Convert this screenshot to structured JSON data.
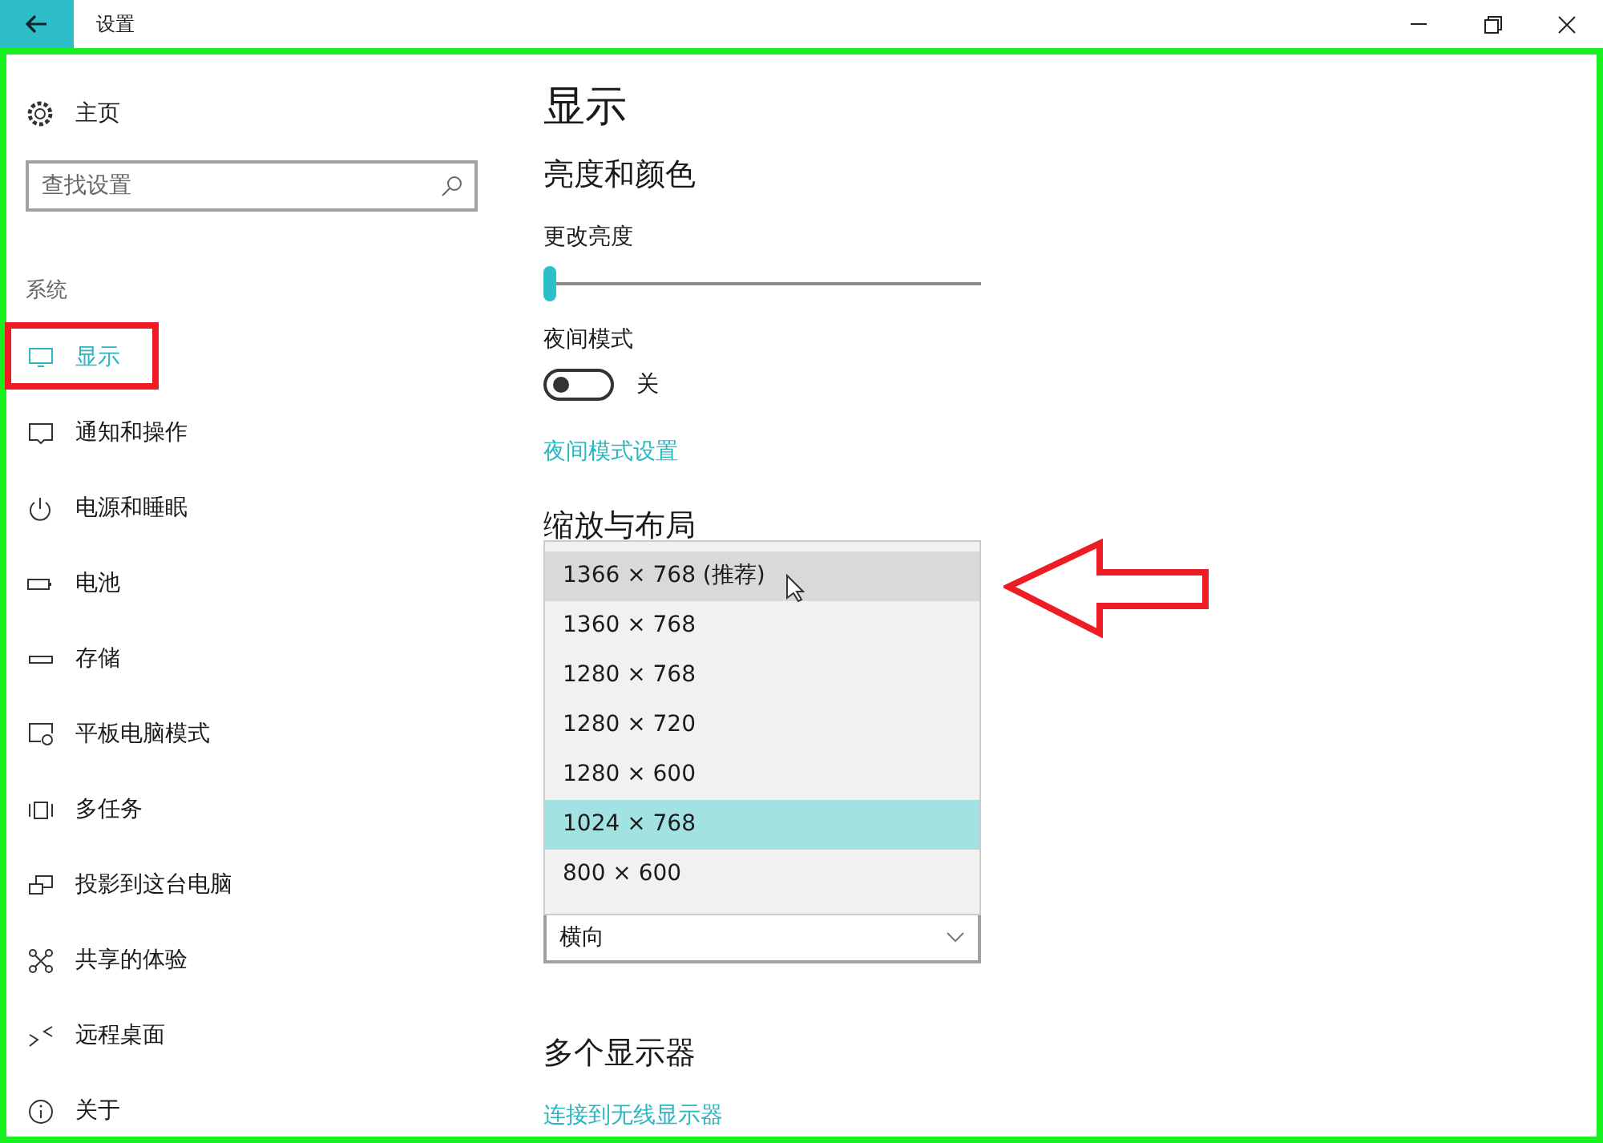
{
  "window": {
    "title": "设置"
  },
  "sidebar": {
    "home": "主页",
    "search": {
      "placeholder": "查找设置"
    },
    "section": "系统",
    "items": [
      {
        "kind": "display",
        "label": "显示",
        "selected": true
      },
      {
        "kind": "notify",
        "label": "通知和操作",
        "selected": false
      },
      {
        "kind": "power",
        "label": "电源和睡眠",
        "selected": false
      },
      {
        "kind": "battery",
        "label": "电池",
        "selected": false
      },
      {
        "kind": "storage",
        "label": "存储",
        "selected": false
      },
      {
        "kind": "tablet",
        "label": "平板电脑模式",
        "selected": false
      },
      {
        "kind": "multitask",
        "label": "多任务",
        "selected": false
      },
      {
        "kind": "project",
        "label": "投影到这台电脑",
        "selected": false
      },
      {
        "kind": "share",
        "label": "共享的体验",
        "selected": false
      },
      {
        "kind": "remote",
        "label": "远程桌面",
        "selected": false
      },
      {
        "kind": "about",
        "label": "关于",
        "selected": false
      }
    ]
  },
  "content": {
    "title": "显示",
    "brightness_section": "亮度和颜色",
    "brightness_label": "更改亮度",
    "brightness": {
      "level": 0.0
    },
    "night_label": "夜间模式",
    "night_mode": {
      "on": false,
      "state_text": "关"
    },
    "night_link": "夜间模式设置",
    "scale_section": "缩放与布局",
    "resolution_menu": [
      {
        "label": "1366 × 768 (推荐)",
        "hovered": true,
        "selected": false
      },
      {
        "label": "1360 × 768",
        "hovered": false,
        "selected": false
      },
      {
        "label": "1280 × 768",
        "hovered": false,
        "selected": false
      },
      {
        "label": "1280 × 720",
        "hovered": false,
        "selected": false
      },
      {
        "label": "1280 × 600",
        "hovered": false,
        "selected": false
      },
      {
        "label": "1024 × 768",
        "hovered": false,
        "selected": true
      },
      {
        "label": "800 × 600",
        "hovered": false,
        "selected": false
      }
    ],
    "orientation": "横向",
    "multi_section": "多个显示器",
    "wireless_link": "连接到无线显示器"
  }
}
